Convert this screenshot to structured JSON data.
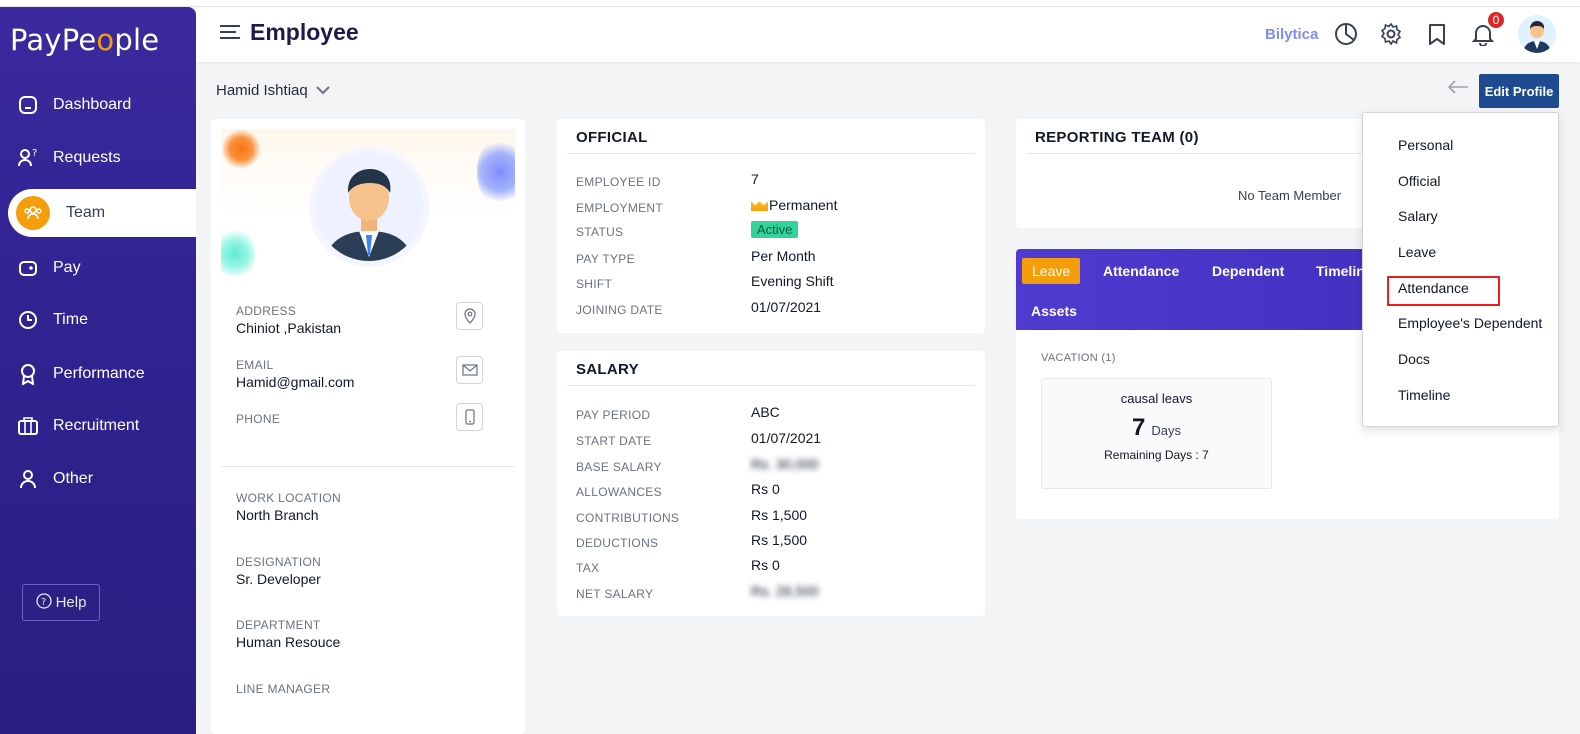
{
  "app": {
    "logo_text": "PayPe",
    "logo_o": "o",
    "logo_end": "ple",
    "page_title": "Employee"
  },
  "sidebar": {
    "items": [
      {
        "label": "Dashboard",
        "icon": "dashboard-icon"
      },
      {
        "label": "Requests",
        "icon": "requests-icon"
      },
      {
        "label": "Team",
        "icon": "team-icon",
        "active": true
      },
      {
        "label": "Pay",
        "icon": "wallet-icon"
      },
      {
        "label": "Time",
        "icon": "clock-icon"
      },
      {
        "label": "Performance",
        "icon": "award-icon"
      },
      {
        "label": "Recruitment",
        "icon": "briefcase-icon"
      },
      {
        "label": "Other",
        "icon": "user-icon"
      }
    ],
    "help_label": "Help"
  },
  "header": {
    "company": "Bilytica",
    "notification_count": "0"
  },
  "employee_select": {
    "value": "Hamid Ishtiaq"
  },
  "actions": {
    "edit_profile_label": "Edit Profile"
  },
  "profile": {
    "address_label": "ADDRESS",
    "address": "Chiniot ,Pakistan",
    "email_label": "EMAIL",
    "email": "Hamid@gmail.com",
    "phone_label": "PHONE",
    "phone": "",
    "work_location_label": "WORK LOCATION",
    "work_location": "North Branch",
    "designation_label": "DESIGNATION",
    "designation": "Sr. Developer",
    "department_label": "DEPARTMENT",
    "department": "Human Resouce",
    "line_manager_label": "LINE MANAGER"
  },
  "official": {
    "title": "OFFICIAL",
    "rows": [
      {
        "label": "EMPLOYEE ID",
        "value": "7"
      },
      {
        "label": "EMPLOYMENT",
        "value": "Permanent"
      },
      {
        "label": "STATUS",
        "value": "Active"
      },
      {
        "label": "PAY TYPE",
        "value": "Per Month"
      },
      {
        "label": "SHIFT",
        "value": "Evening Shift"
      },
      {
        "label": "JOINING DATE",
        "value": "01/07/2021"
      }
    ]
  },
  "salary": {
    "title": "SALARY",
    "rows": [
      {
        "label": "PAY PERIOD",
        "value": "ABC"
      },
      {
        "label": "START DATE",
        "value": "01/07/2021"
      },
      {
        "label": "BASE SALARY",
        "value": "Rs. 30,000"
      },
      {
        "label": "ALLOWANCES",
        "value": "Rs 0"
      },
      {
        "label": "CONTRIBUTIONS",
        "value": "Rs 1,500"
      },
      {
        "label": "DEDUCTIONS",
        "value": "Rs 1,500"
      },
      {
        "label": "TAX",
        "value": "Rs 0"
      },
      {
        "label": "NET SALARY",
        "value": "Rs. 28,500"
      }
    ]
  },
  "reporting_team": {
    "title": "REPORTING TEAM (0)",
    "empty_text": "No Team Member"
  },
  "tabs": {
    "items": [
      "Leave",
      "Attendance",
      "Dependent",
      "Timeline",
      "Assets"
    ],
    "vacation_label": "VACATION (1)",
    "leave_card": {
      "name": "causal leavs",
      "days": "7",
      "days_unit": "Days",
      "remaining": "Remaining Days : 7"
    }
  },
  "dropdown": {
    "items": [
      "Personal",
      "Official",
      "Salary",
      "Leave",
      "Attendance",
      "Employee's Dependent",
      "Docs",
      "Timeline"
    ],
    "highlighted": "Attendance"
  },
  "colors": {
    "sidebar": "#2f2390",
    "accent": "#f59e0b",
    "primary_button": "#1e4b8f",
    "highlight": "#ef1c1c"
  }
}
